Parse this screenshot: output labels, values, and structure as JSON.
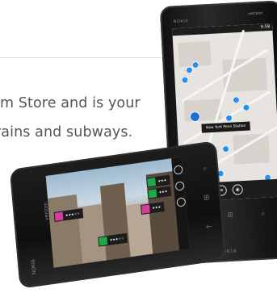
{
  "text": {
    "line1": "m Store and is your",
    "line2": "rains and subways."
  },
  "phone_right": {
    "brand_top": "NOKIA",
    "carrier": "verizon",
    "status_time": "6:58",
    "callout": "New York Penn Station",
    "brand_bottom": "NOKIA"
  },
  "phone_left": {
    "brand": "NOKIA",
    "carrier": "verizon"
  },
  "colors": {
    "pin": "#2d8ee8",
    "tag_green": "#1fa84a",
    "tag_pink": "#d43c9a",
    "text": "#555555"
  }
}
